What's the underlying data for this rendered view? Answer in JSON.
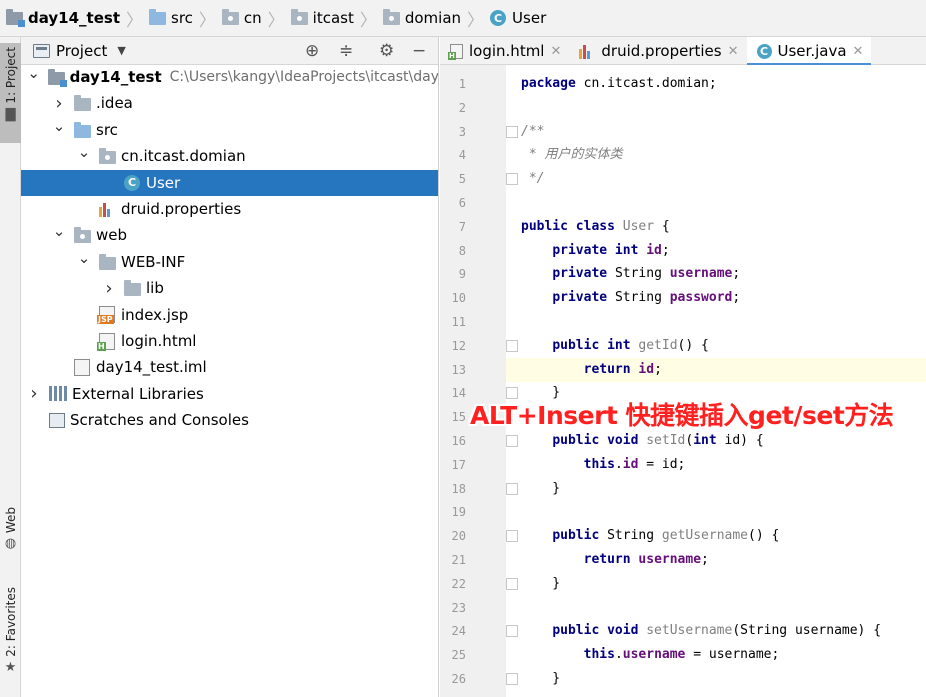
{
  "breadcrumb": [
    "day14_test",
    "src",
    "cn",
    "itcast",
    "domian",
    "User"
  ],
  "left_strip": {
    "project_tab": "1: Project",
    "web_tab": "Web",
    "favorites_tab": "2: Favorites"
  },
  "project_panel": {
    "title": "Project",
    "tree": [
      {
        "label": "day14_test",
        "path": "C:\\Users\\kangy\\IdeaProjects\\itcast\\day",
        "depth": 0,
        "expand": "open",
        "icon": "module-folder-icon",
        "bold": true
      },
      {
        "label": ".idea",
        "depth": 1,
        "expand": "closed",
        "icon": "folder-icon"
      },
      {
        "label": "src",
        "depth": 1,
        "expand": "open",
        "icon": "source-folder-icon"
      },
      {
        "label": "cn.itcast.domian",
        "depth": 2,
        "expand": "open",
        "icon": "package-icon"
      },
      {
        "label": "User",
        "depth": 3,
        "expand": "none",
        "icon": "java-class-icon",
        "selected": true
      },
      {
        "label": "druid.properties",
        "depth": 2,
        "expand": "none",
        "icon": "properties-file-icon"
      },
      {
        "label": "web",
        "depth": 1,
        "expand": "open",
        "icon": "web-folder-icon"
      },
      {
        "label": "WEB-INF",
        "depth": 2,
        "expand": "open",
        "icon": "folder-icon"
      },
      {
        "label": "lib",
        "depth": 3,
        "expand": "closed",
        "icon": "folder-icon"
      },
      {
        "label": "index.jsp",
        "depth": 2,
        "expand": "none",
        "icon": "jsp-file-icon"
      },
      {
        "label": "login.html",
        "depth": 2,
        "expand": "none",
        "icon": "html-file-icon"
      },
      {
        "label": "day14_test.iml",
        "depth": 1,
        "expand": "none",
        "icon": "iml-file-icon"
      },
      {
        "label": "External Libraries",
        "depth": 0,
        "expand": "closed",
        "icon": "library-icon"
      },
      {
        "label": "Scratches and Consoles",
        "depth": 0,
        "expand": "none",
        "icon": "scratches-icon"
      }
    ]
  },
  "editor_tabs": [
    {
      "label": "login.html",
      "icon": "html-file-icon",
      "active": false
    },
    {
      "label": "druid.properties",
      "icon": "properties-file-icon",
      "active": false
    },
    {
      "label": "User.java",
      "icon": "java-class-icon",
      "active": true
    }
  ],
  "editor": {
    "current_line": 13,
    "lines": [
      {
        "n": "1",
        "tokens": [
          [
            "kw",
            "package"
          ],
          [
            "",
            " cn.itcast.domian;"
          ]
        ]
      },
      {
        "n": "2",
        "tokens": []
      },
      {
        "n": "3",
        "tokens": [
          [
            "cmt",
            "/**"
          ]
        ],
        "fold": true
      },
      {
        "n": "4",
        "tokens": [
          [
            "cmt",
            " * 用户的实体类"
          ]
        ]
      },
      {
        "n": "5",
        "tokens": [
          [
            "cmt",
            " */"
          ]
        ],
        "fold": true
      },
      {
        "n": "6",
        "tokens": []
      },
      {
        "n": "7",
        "tokens": [
          [
            "kw",
            "public class "
          ],
          [
            "typ",
            "User"
          ],
          [
            "",
            " {"
          ]
        ]
      },
      {
        "n": "8",
        "tokens": [
          [
            "",
            "    "
          ],
          [
            "kw",
            "private int "
          ],
          [
            "fld",
            "id"
          ],
          [
            "",
            ";"
          ]
        ]
      },
      {
        "n": "9",
        "tokens": [
          [
            "",
            "    "
          ],
          [
            "kw",
            "private "
          ],
          [
            "",
            "String "
          ],
          [
            "fld",
            "username"
          ],
          [
            "",
            ";"
          ]
        ]
      },
      {
        "n": "10",
        "tokens": [
          [
            "",
            "    "
          ],
          [
            "kw",
            "private "
          ],
          [
            "",
            "String "
          ],
          [
            "fld",
            "password"
          ],
          [
            "",
            ";"
          ]
        ]
      },
      {
        "n": "11",
        "tokens": []
      },
      {
        "n": "12",
        "tokens": [
          [
            "",
            "    "
          ],
          [
            "kw",
            "public int "
          ],
          [
            "mth",
            "getId"
          ],
          [
            "",
            "() {"
          ]
        ],
        "fold": true
      },
      {
        "n": "13",
        "tokens": [
          [
            "",
            "        "
          ],
          [
            "kw",
            "return "
          ],
          [
            "fld",
            "id"
          ],
          [
            "",
            ";"
          ]
        ]
      },
      {
        "n": "14",
        "tokens": [
          [
            "",
            "    }"
          ]
        ],
        "fold": true
      },
      {
        "n": "15",
        "tokens": []
      },
      {
        "n": "16",
        "tokens": [
          [
            "",
            "    "
          ],
          [
            "kw",
            "public void "
          ],
          [
            "mth",
            "setId"
          ],
          [
            "",
            "("
          ],
          [
            "kw",
            "int "
          ],
          [
            "",
            "id) {"
          ]
        ],
        "fold": true
      },
      {
        "n": "17",
        "tokens": [
          [
            "",
            "        "
          ],
          [
            "kw",
            "this"
          ],
          [
            "",
            "."
          ],
          [
            "fld",
            "id"
          ],
          [
            "",
            " = id;"
          ]
        ]
      },
      {
        "n": "18",
        "tokens": [
          [
            "",
            "    }"
          ]
        ],
        "fold": true
      },
      {
        "n": "19",
        "tokens": []
      },
      {
        "n": "20",
        "tokens": [
          [
            "",
            "    "
          ],
          [
            "kw",
            "public "
          ],
          [
            "",
            "String "
          ],
          [
            "mth",
            "getUsername"
          ],
          [
            "",
            "() {"
          ]
        ],
        "fold": true
      },
      {
        "n": "21",
        "tokens": [
          [
            "",
            "        "
          ],
          [
            "kw",
            "return "
          ],
          [
            "fld",
            "username"
          ],
          [
            "",
            ";"
          ]
        ]
      },
      {
        "n": "22",
        "tokens": [
          [
            "",
            "    }"
          ]
        ],
        "fold": true
      },
      {
        "n": "23",
        "tokens": []
      },
      {
        "n": "24",
        "tokens": [
          [
            "",
            "    "
          ],
          [
            "kw",
            "public void "
          ],
          [
            "mth",
            "setUsername"
          ],
          [
            "",
            "(String username) {"
          ]
        ],
        "fold": true
      },
      {
        "n": "25",
        "tokens": [
          [
            "",
            "        "
          ],
          [
            "kw",
            "this"
          ],
          [
            "",
            "."
          ],
          [
            "fld",
            "username"
          ],
          [
            "",
            " = username;"
          ]
        ]
      },
      {
        "n": "26",
        "tokens": [
          [
            "",
            "    }"
          ]
        ],
        "fold": true
      }
    ]
  },
  "annotation": "ALT+Insert  快捷键插入get/set方法",
  "colors": {
    "selection": "#2675bf",
    "annotation": "#ff2020",
    "keyword": "#000080",
    "field": "#660e7a"
  }
}
